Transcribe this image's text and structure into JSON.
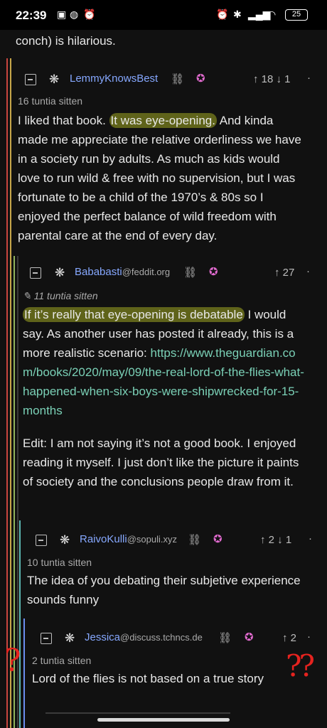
{
  "status": {
    "time": "22:39",
    "battery": "25",
    "icons": [
      "sim-card-icon",
      "theme-icon",
      "alarm-icon",
      "alarm-clock-icon",
      "bluetooth-icon",
      "signal-icon",
      "wifi-icon",
      "battery-icon"
    ]
  },
  "prev_comment_tail": "conch) is hilarious.",
  "comments": [
    {
      "username": "LemmyKnowsBest",
      "instance": "",
      "time": "16 tuntia sitten",
      "votes": "↑ 18 ↓ 1",
      "body_pre": "I liked that book. ",
      "body_highlight": "It was eye-opening.",
      "body_post": " And kinda made me appreciate the relative orderliness we have in a society run by adults. As much as kids would love to run wild & free with no supervision, but I was fortunate to be a child of the 1970’s & 80s so I enjoyed the perfect balance of wild freedom with parental care at the end of every day."
    },
    {
      "username": "Bababasti",
      "instance": "@feddit.org",
      "time": "11 tuntia sitten",
      "votes": "↑ 27",
      "body_highlight": "If it’s really that eye-opening is debatable",
      "body_post": " I would say. As another user has posted it already, this is a more realistic scenario: ",
      "link": "https://www.theguardian.com/books/2020/may/09/the-real-lord-of-the-flies-what-happened-when-six-boys-were-shipwrecked-for-15-months",
      "body_edit": "Edit: I am not saying it’s not a good book. I enjoyed reading it myself. I just don’t like the picture it paints of society and the conclusions people draw from it."
    },
    {
      "username": "RaivoKulli",
      "instance": "@sopuli.xyz",
      "time": "10 tuntia sitten",
      "votes": "↑ 2 ↓ 1",
      "body": "The idea of you debating their subjetive experience sounds funny"
    },
    {
      "username": "Jessica",
      "instance": "@discuss.tchncs.de",
      "time": "2 tuntia sitten",
      "votes": "↑ 2",
      "body": "Lord of the flies is not based on a true story"
    }
  ],
  "annotations": [
    "?",
    "??"
  ],
  "colors": {
    "thread_lines": [
      "#c9463f",
      "#c7a74a",
      "#8fb45c",
      "#5bb7b2",
      "#6b8ef0"
    ],
    "highlight": "#ced628",
    "link": "#7ad0b6",
    "username": "#86a8ff",
    "annotation": "#e6231f"
  }
}
